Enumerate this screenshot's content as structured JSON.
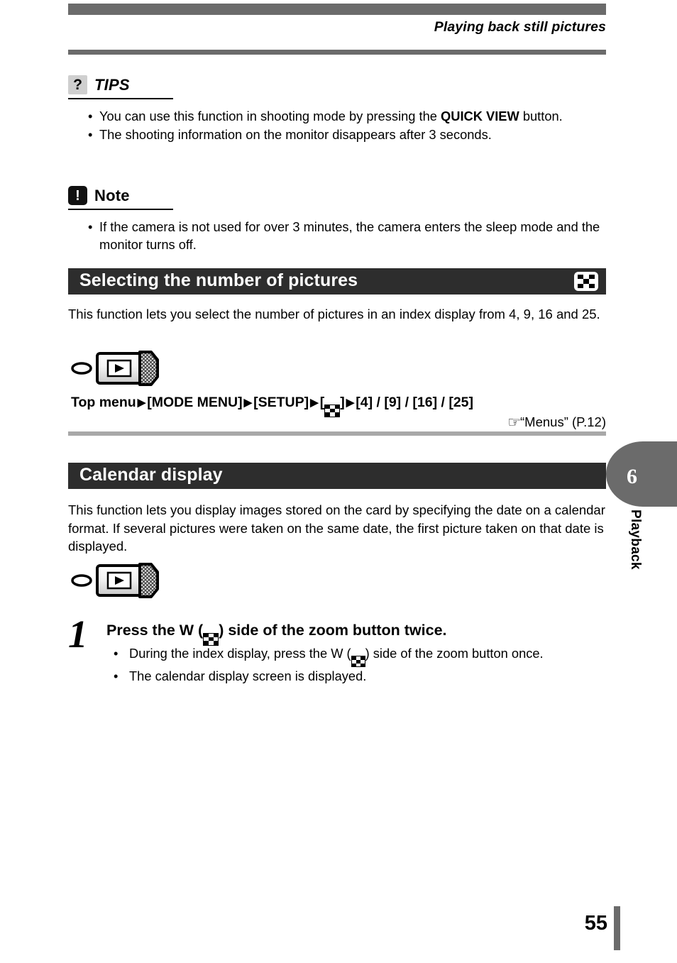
{
  "header": {
    "title": "Playing back still pictures"
  },
  "tips": {
    "badge": "?",
    "badge_icon": "question-mark-icon",
    "label": "TIPS",
    "bullets": [
      {
        "before": "You can use this function in shooting mode by pressing the ",
        "bold": "QUICK VIEW",
        "after": " button."
      },
      {
        "before": "The shooting information on the monitor disappears after 3 seconds.",
        "bold": "",
        "after": ""
      }
    ]
  },
  "note": {
    "badge": "!",
    "badge_icon": "exclamation-mark-icon",
    "label": "Note",
    "bullets": [
      {
        "before": "If the camera is not used for over 3 minutes, the camera enters the sleep mode and the monitor turns off.",
        "bold": "",
        "after": ""
      }
    ]
  },
  "section_numbers": {
    "heading": "Selecting the number of pictures",
    "heading_icon": "index-display-icon",
    "body": "This function lets you select the number of pictures in an index display from 4, 9, 16 and 25.",
    "dial_icon": "playback-mode-dial-icon",
    "menu_path": {
      "start": "Top menu",
      "arrow": "▶",
      "step1": "[MODE MENU]",
      "step2": "[SETUP]",
      "step3_open": "[",
      "step3_icon": "index-display-icon",
      "step3_close": "]",
      "step4": "[4] / [9] / [16] / [25]"
    },
    "reference": {
      "hand_icon": "pointing-hand-icon",
      "hand": "☞",
      "text": "“Menus” (P.12)"
    }
  },
  "section_calendar": {
    "heading": "Calendar display",
    "body": "This function lets you display images stored on the card by specifying the date on a calendar format. If several pictures were taken on the same date, the first picture taken on that date is displayed.",
    "dial_icon": "playback-mode-dial-icon",
    "step": {
      "number": "1",
      "title_before": "Press the W (",
      "title_icon": "index-display-icon",
      "title_after": ") side of the zoom button twice.",
      "bullets": [
        {
          "before": "During the index display, press the W (",
          "icon": "index-display-icon",
          "after": ") side of the zoom button once."
        },
        {
          "before": "The calendar display screen is displayed.",
          "icon": "",
          "after": ""
        }
      ]
    }
  },
  "chapter_tab": {
    "number": "6",
    "label": "Playback"
  },
  "footer": {
    "page_number": "55"
  },
  "colors": {
    "gray_bar": "#6b6b6b",
    "section_bar": "#2d2d2d",
    "rule_gray": "#a8a8a8",
    "tips_badge_bg": "#cfcfcf"
  },
  "glyphs": {
    "bullet": "•",
    "arrow": "▶"
  }
}
